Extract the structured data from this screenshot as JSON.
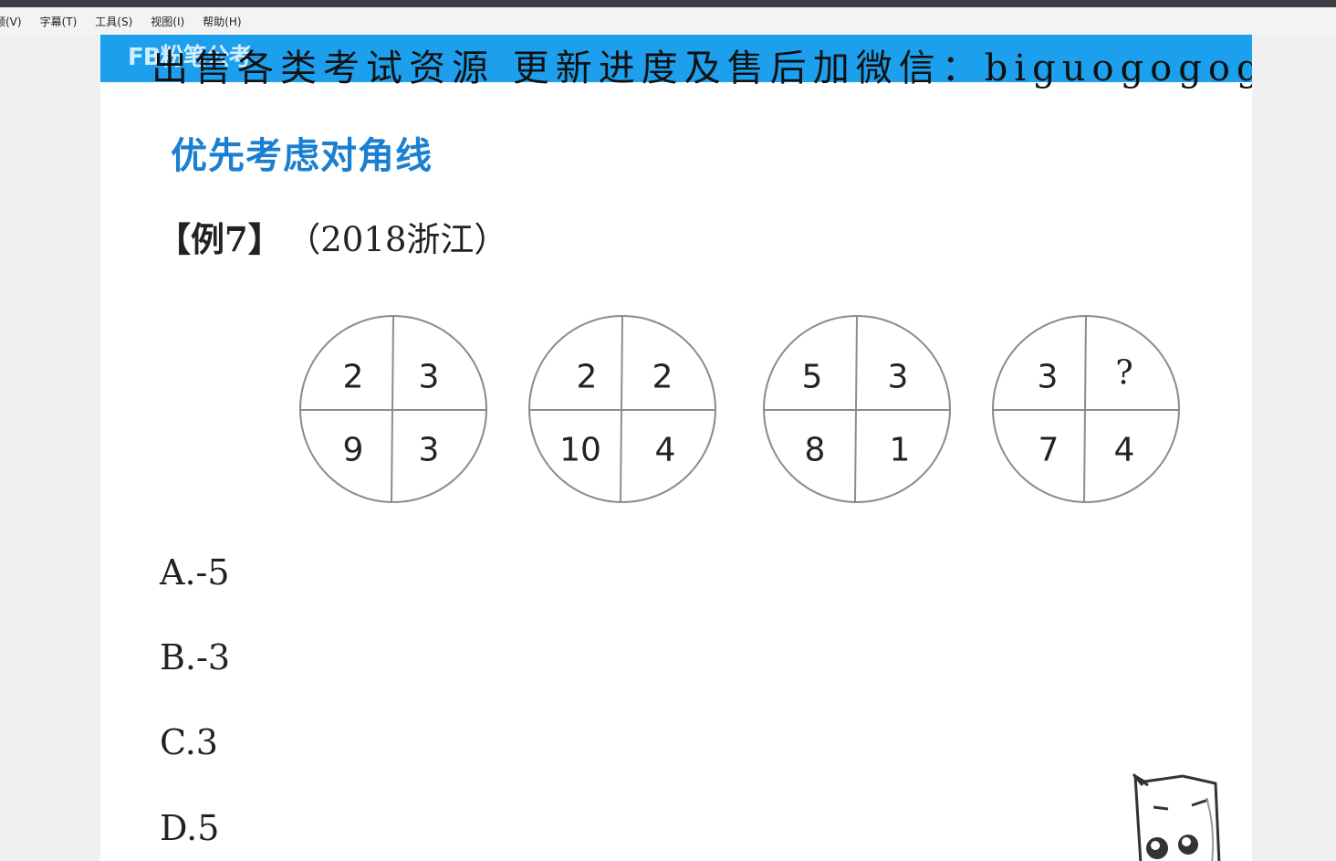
{
  "menu": [
    "频(V)",
    "字幕(T)",
    "工具(S)",
    "视图(I)",
    "帮助(H)"
  ],
  "banner": {
    "logo": "FB粉笔公考",
    "text": "出售各类考试资源 更新进度及售后加微信：biguogogogo"
  },
  "heading": "优先考虑对角线",
  "example": {
    "tag": "【例7】",
    "source": "（2018浙江）"
  },
  "figures": [
    {
      "top_left": "2",
      "top_right": "3",
      "bottom_left": "9",
      "bottom_right": "3"
    },
    {
      "top_left": "2",
      "top_right": "2",
      "bottom_left": "10",
      "bottom_right": "4"
    },
    {
      "top_left": "5",
      "top_right": "3",
      "bottom_left": "8",
      "bottom_right": "1"
    },
    {
      "top_left": "3",
      "top_right": "?",
      "bottom_left": "7",
      "bottom_right": "4"
    }
  ],
  "options": [
    "A.-5",
    "B.-3",
    "C.3",
    "D.5"
  ]
}
